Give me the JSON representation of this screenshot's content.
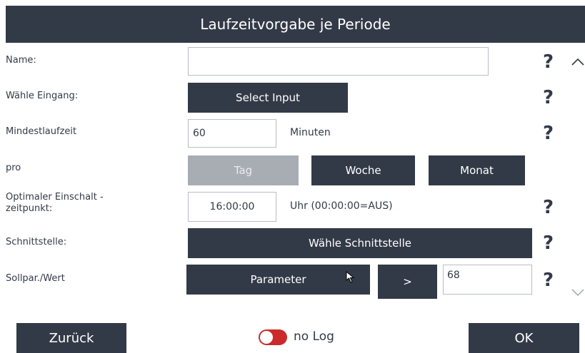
{
  "header": {
    "title": "Laufzeitvorgabe je Periode"
  },
  "form": {
    "name_label": "Name:",
    "name_value": "",
    "input_label": "Wähle Eingang:",
    "input_button": "Select Input",
    "runtime_label": "Mindestlaufzeit",
    "runtime_value": "60",
    "runtime_unit": "Minuten",
    "period_label": "pro",
    "period_options": [
      "Tag",
      "Woche",
      "Monat"
    ],
    "period_selected": "Tag",
    "optimal_label_line1": "Optimaler Einschalt -",
    "optimal_label_line2": "zeitpunkt:",
    "optimal_value": "16:00:00",
    "optimal_unit": "Uhr (00:00:00=AUS)",
    "interface_label": "Schnittstelle:",
    "interface_button": "Wähle Schnittstelle",
    "setpoint_label": "Sollpar./Wert",
    "setpoint_button": "Parameter",
    "setpoint_arrow": ">",
    "setpoint_value": "68",
    "help_symbol": "?"
  },
  "footer": {
    "back_label": "Zurück",
    "log_label": "no Log",
    "ok_label": "OK"
  },
  "colors": {
    "dark": "#333a47",
    "disabled": "#a8adb4",
    "toggle": "#cc2a2a"
  }
}
